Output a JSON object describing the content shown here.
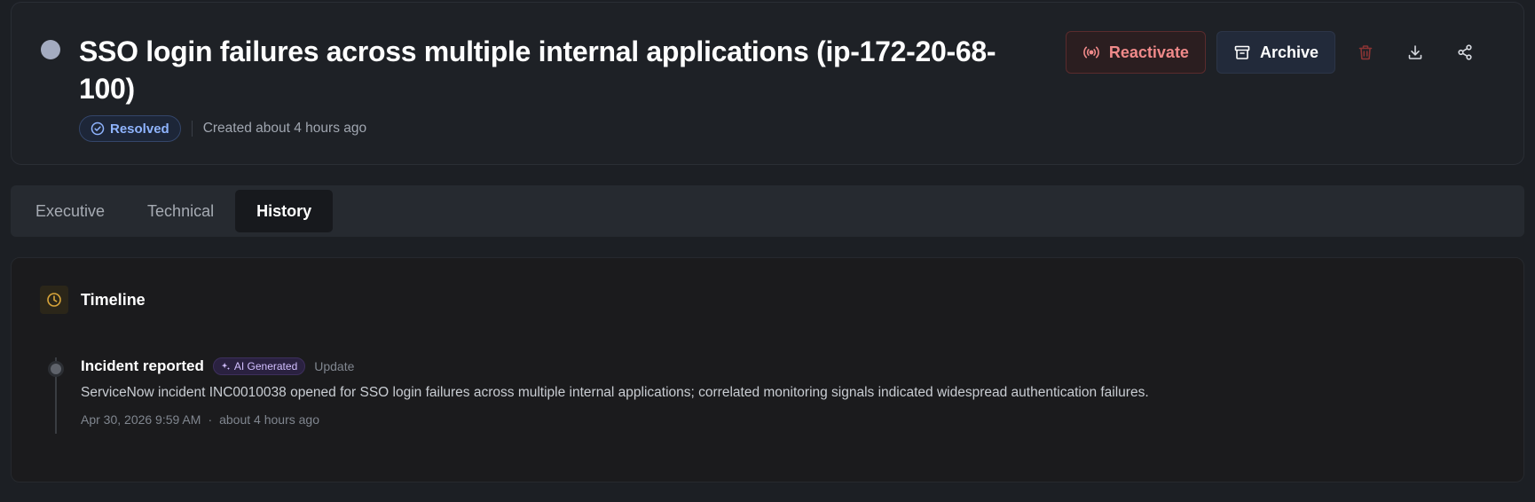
{
  "incident": {
    "title": "SSO login failures across multiple internal applications (ip-172-20-68-100)",
    "status": "Resolved",
    "created": "Created about 4 hours ago"
  },
  "actions": {
    "reactivate_label": "Reactivate",
    "archive_label": "Archive",
    "icons": [
      "delete-icon",
      "download-icon",
      "share-icon"
    ]
  },
  "tabs": [
    {
      "label": "Executive",
      "active": false
    },
    {
      "label": "Technical",
      "active": false
    },
    {
      "label": "History",
      "active": true
    }
  ],
  "timeline": {
    "title": "Timeline",
    "entries": [
      {
        "title": "Incident reported",
        "badge": "AI Generated",
        "type": "Update",
        "description": "ServiceNow incident INC0010038 opened for SSO login failures across multiple internal applications; correlated monitoring signals indicated widespread authentication failures.",
        "timestamp": "Apr 30, 2026 9:59 AM",
        "separator": "·",
        "relative": "about 4 hours ago"
      }
    ]
  },
  "colors": {
    "background": "#1c1f24",
    "resolved_accent": "#8fb4ff",
    "reactivate_accent": "#f08a8a",
    "timeline_icon": "#d9a53a",
    "ai_badge": "#d2bfff"
  }
}
